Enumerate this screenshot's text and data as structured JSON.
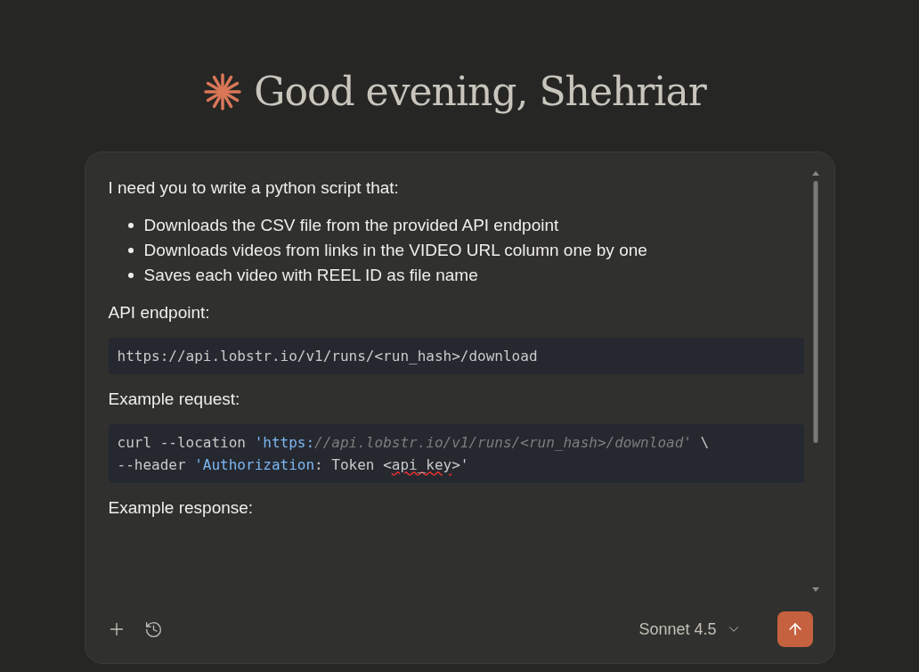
{
  "greeting": "Good evening, Shehriar",
  "prompt": {
    "blocks": [
      {
        "kind": "paragraph",
        "text": "I need you to write a python script that:"
      },
      {
        "kind": "list",
        "items": [
          "Downloads the CSV file from the provided API endpoint",
          "Downloads videos from links in the VIDEO URL column one by one",
          "Saves each video with REEL ID as file name"
        ]
      },
      {
        "kind": "paragraph",
        "text": "API endpoint:"
      },
      {
        "kind": "code",
        "lines": [
          [
            {
              "kind": "plain",
              "text": "https://api.lobstr.io/v1/runs/<run_hash>/download"
            }
          ]
        ]
      },
      {
        "kind": "paragraph",
        "text": "Example request:"
      },
      {
        "kind": "code",
        "lines": [
          [
            {
              "kind": "plain",
              "text": "curl --location "
            },
            {
              "kind": "string",
              "text": "'https:"
            },
            {
              "kind": "comment",
              "text": "//api.lobstr.io/v1/runs/<run_hash>/download'"
            },
            {
              "kind": "plain",
              "text": " \\"
            }
          ],
          [
            {
              "kind": "plain",
              "text": "--header "
            },
            {
              "kind": "string",
              "text": "'Authorization"
            },
            {
              "kind": "plain",
              "text": ": Token <"
            },
            {
              "kind": "misspelled",
              "text": "api_key"
            },
            {
              "kind": "plain",
              "text": ">'"
            }
          ]
        ]
      },
      {
        "kind": "paragraph",
        "text": "Example response:"
      }
    ]
  },
  "model": "Sonnet 4.5"
}
